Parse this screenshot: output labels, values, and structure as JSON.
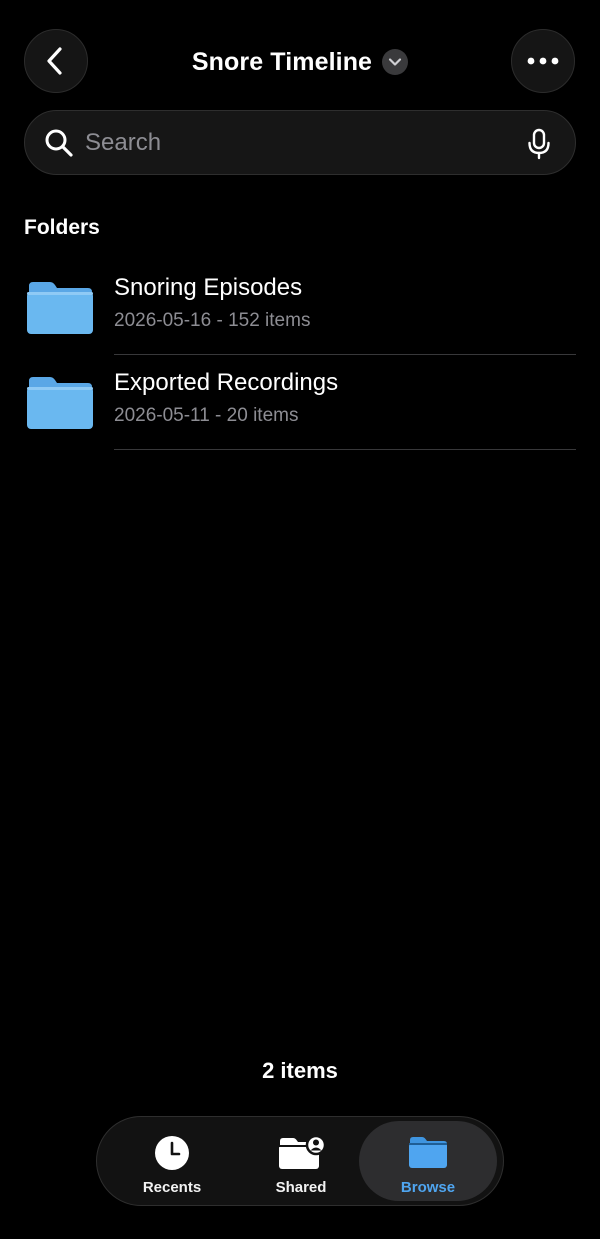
{
  "header": {
    "title": "Snore Timeline",
    "back_icon": "chevron-left-icon",
    "more_icon": "ellipsis-icon",
    "title_menu_icon": "chevron-down-icon"
  },
  "search": {
    "placeholder": "Search",
    "value": "",
    "icon": "search-icon",
    "mic_icon": "microphone-icon"
  },
  "folders": {
    "section_title": "Folders",
    "items": [
      {
        "name": "Snoring Episodes",
        "meta": "2026-05-16 - 152 items",
        "icon": "folder-icon"
      },
      {
        "name": "Exported Recordings",
        "meta": "2026-05-11 - 20 items",
        "icon": "folder-icon"
      }
    ]
  },
  "footer": {
    "count": "2 items"
  },
  "tabs": [
    {
      "label": "Recents",
      "icon": "clock-icon",
      "selected": false
    },
    {
      "label": "Shared",
      "icon": "shared-folder-icon",
      "selected": false
    },
    {
      "label": "Browse",
      "icon": "folder-icon",
      "selected": true
    }
  ],
  "colors": {
    "background": "#000000",
    "accent": "#4fa5f0",
    "folder": "#64b4ee",
    "secondary_text": "#8d8d93"
  }
}
